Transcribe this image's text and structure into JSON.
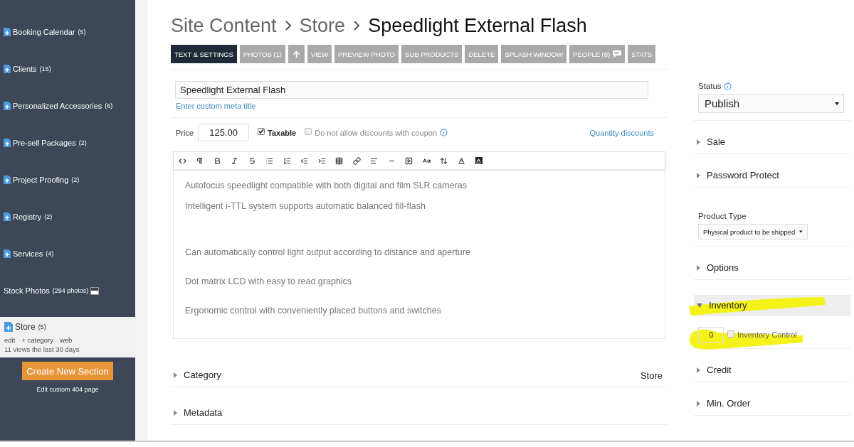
{
  "sidebar": {
    "sections": [
      {
        "kind": "page",
        "name": "Booking Calendar",
        "count": "(5)",
        "selected": false
      },
      {
        "kind": "page",
        "name": "Clients",
        "count": "(15)",
        "selected": false
      },
      {
        "kind": "page",
        "name": "Personalized Accessories",
        "count": "(6)",
        "selected": false
      },
      {
        "kind": "page",
        "name": "Pre-sell Packages",
        "count": "(2)",
        "selected": false
      },
      {
        "kind": "page",
        "name": "Project Proofing",
        "count": "(2)",
        "selected": false
      },
      {
        "kind": "page",
        "name": "Registry",
        "count": "(2)",
        "selected": false
      },
      {
        "kind": "page",
        "name": "Services",
        "count": "(4)",
        "selected": false
      },
      {
        "kind": "photos",
        "name": "Stock Photos",
        "count": "(294 photos)",
        "selected": false
      },
      {
        "kind": "page",
        "name": "Store",
        "count": "(5)",
        "selected": true,
        "links": [
          "edit",
          "+ category",
          "web"
        ],
        "stats": "11 views the last 30 days"
      }
    ],
    "create_button": "Create New Section",
    "footer_link": "Edit custom 404 page"
  },
  "breadcrumb": [
    {
      "label": "Site Content",
      "current": false
    },
    {
      "label": "Store",
      "current": false
    },
    {
      "label": "Speedlight External Flash",
      "current": true
    }
  ],
  "tabs": [
    {
      "kind": "label",
      "label": "TEXT & SETTINGS",
      "selected": true
    },
    {
      "kind": "label",
      "label": "PHOTOS (1)",
      "selected": false
    },
    {
      "kind": "icon",
      "selected": false
    },
    {
      "kind": "label",
      "label": "VIEW",
      "selected": false
    },
    {
      "kind": "label",
      "label": "PREVIEW PHOTO",
      "selected": false
    },
    {
      "kind": "label",
      "label": "SUB PRODUCTS",
      "selected": false
    },
    {
      "kind": "label",
      "label": "DELETE",
      "selected": false
    },
    {
      "kind": "label",
      "label": "SPLASH WINDOW",
      "selected": false
    },
    {
      "kind": "label_icon",
      "label": "PEOPLE (8)",
      "selected": false
    },
    {
      "kind": "label",
      "label": "STATS",
      "selected": false
    }
  ],
  "product": {
    "title_field": {
      "value": "Speedlight External Flash"
    },
    "meta_link": "Enter custom meta title",
    "price": {
      "label": "Price",
      "value": "125.00"
    },
    "checks": [
      {
        "label": "Taxable",
        "checked": true
      },
      {
        "label": "Do not allow discounts with coupon",
        "checked": false,
        "info": true
      }
    ],
    "quantity_link": "Quantity discounts"
  },
  "editor": {
    "paragraphs": [
      "Autofocus speedlight compatible with both digital and film SLR cameras",
      "Intelligent i-TTL system supports automatic balanced fill-flash",
      "Can automatically control light output according to distance and aperture",
      "Dot matrix LCD with easy to read graphics",
      "Ergonomic control with conveniently placed buttons and switches"
    ]
  },
  "left_sections": [
    {
      "label": "Category",
      "value": "Store",
      "expanded": false
    },
    {
      "label": "Metadata",
      "expanded": false
    }
  ],
  "right_panel": {
    "status": {
      "label": "Status",
      "info": true,
      "value": "Publish"
    },
    "items": [
      {
        "kind": "collapsible",
        "label": "Sale",
        "expanded": false
      },
      {
        "kind": "collapsible",
        "label": "Password Protect",
        "expanded": false
      },
      {
        "kind": "select",
        "label": "Product Type",
        "value": "Physical product to be shipped"
      },
      {
        "kind": "collapsible",
        "label": "Options",
        "expanded": false
      },
      {
        "kind": "collapsible",
        "label": "Inventory",
        "expanded": true,
        "highlighted": true,
        "content": {
          "quantity": "0",
          "checkbox": {
            "label": "Inventory Control",
            "checked": false
          },
          "highlighted": true
        }
      },
      {
        "kind": "collapsible",
        "label": "Credit",
        "expanded": false
      },
      {
        "kind": "collapsible",
        "label": "Min. Order",
        "expanded": false
      }
    ]
  }
}
